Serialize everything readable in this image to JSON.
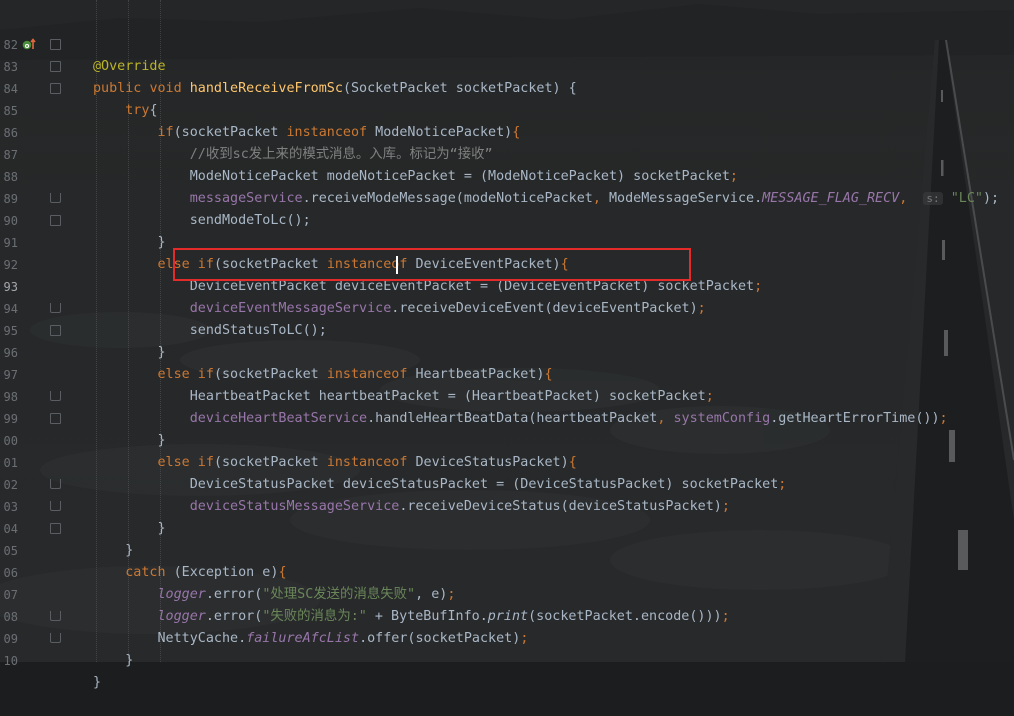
{
  "editor": {
    "current_line": "93",
    "lines": [
      {
        "num": "82",
        "text": ""
      },
      {
        "num": "83",
        "text": ""
      },
      {
        "num": "84",
        "text": ""
      },
      {
        "num": "85",
        "text": ""
      },
      {
        "num": "86",
        "text": ""
      },
      {
        "num": "87",
        "text": ""
      },
      {
        "num": "88",
        "text": ""
      },
      {
        "num": "89",
        "text": ""
      },
      {
        "num": "90",
        "text": ""
      },
      {
        "num": "91",
        "text": ""
      },
      {
        "num": "92",
        "text": ""
      },
      {
        "num": "93",
        "text": ""
      },
      {
        "num": "94",
        "text": ""
      },
      {
        "num": "95",
        "text": ""
      },
      {
        "num": "96",
        "text": ""
      },
      {
        "num": "97",
        "text": ""
      },
      {
        "num": "98",
        "text": ""
      },
      {
        "num": "99",
        "text": ""
      },
      {
        "num": "00",
        "text": ""
      },
      {
        "num": "01",
        "text": ""
      },
      {
        "num": "02",
        "text": ""
      },
      {
        "num": "03",
        "text": ""
      },
      {
        "num": "04",
        "text": ""
      },
      {
        "num": "05",
        "text": ""
      },
      {
        "num": "06",
        "text": ""
      },
      {
        "num": "07",
        "text": ""
      },
      {
        "num": "08",
        "text": ""
      },
      {
        "num": "09",
        "text": ""
      },
      {
        "num": "10",
        "text": ""
      }
    ]
  },
  "tokens": {
    "l82_ann": "@Override",
    "l83_public": "public",
    "l83_void": "void",
    "l83_name": "handleReceiveFromSc",
    "l83_params": "(SocketPacket socketPacket) {",
    "l84_try": "try",
    "l84_brace": "{",
    "l85_if": "if",
    "l85_a": "(socketPacket ",
    "l85_instanceof": "instanceof",
    "l85_b": " ModeNoticePacket)",
    "l85_brace": "{",
    "l86_comment": "//收到sc发上来的模式消息。入库。标记为“接收”",
    "l87_a": "ModeNoticePacket modeNoticePacket = ",
    "l87_b": "(ModeNoticePacket) socketPacket",
    "l87_semi": ";",
    "l88_svc": "messageService",
    "l88_a": ".receiveModeMessage(modeNoticePacket",
    "l88_comma": ",",
    "l88_b": " ModeMessageService.",
    "l88_const": "MESSAGE_FLAG_RECV",
    "l88_comma2": ",",
    "l88_hint": "s:",
    "l88_str": "\"LC\"",
    "l88_end": ");",
    "l89": "sendModeToLc();",
    "l90": "}",
    "l91_else": "else if",
    "l91_a": "(socketPacket ",
    "l91_instanceof": "instanceof",
    "l91_b": " DeviceEventPacket)",
    "l91_brace": "{",
    "l92_a": "DeviceEventPacket deviceEventPacket = ",
    "l92_b": "(DeviceEventPacket) socketPacket",
    "l92_semi": ";",
    "l93_svc": "deviceEventMessageService",
    "l93_a": ".receiveDeviceEvent(deviceEventPacket)",
    "l93_semi": ";",
    "l94": "sendStatusToLC();",
    "l95": "}",
    "l96_else": "else if",
    "l96_a": "(socketPacket ",
    "l96_instanceof": "instanceof",
    "l96_b": " HeartbeatPacket)",
    "l96_brace": "{",
    "l97_a": "HeartbeatPacket heartbeatPacket = ",
    "l97_b": "(HeartbeatPacket) socketPacket",
    "l97_semi": ";",
    "l98_svc": "deviceHeartBeatService",
    "l98_a": ".handleHeartBeatData(heartbeatPacket",
    "l98_comma": ",",
    "l98_cfg": " systemConfig",
    "l98_b": ".getHeartErrorTime())",
    "l98_semi": ";",
    "l99": "}",
    "l00_else": "else if",
    "l00_a": "(socketPacket ",
    "l00_instanceof": "instanceof",
    "l00_b": " DeviceStatusPacket)",
    "l00_brace": "{",
    "l01_a": "DeviceStatusPacket deviceStatusPacket = ",
    "l01_b": "(DeviceStatusPacket) socketPacket",
    "l01_semi": ";",
    "l02_svc": "deviceStatusMessageService",
    "l02_a": ".receiveDeviceStatus(deviceStatusPacket)",
    "l02_semi": ";",
    "l03": "}",
    "l04": "}",
    "l05_catch": "catch",
    "l05_a": " (Exception e)",
    "l05_brace": "{",
    "l06_logger": "logger",
    "l06_a": ".error(",
    "l06_str": "\"处理SC发送的消息失败\"",
    "l06_b": ", e)",
    "l06_semi": ";",
    "l07_logger": "logger",
    "l07_a": ".error(",
    "l07_str": "\"失败的消息为:\"",
    "l07_b": " + ByteBufInfo.",
    "l07_print": "print",
    "l07_c": "(socketPacket.encode()))",
    "l07_semi": ";",
    "l08_a": "NettyCache.",
    "l08_field": "failureAfcList",
    "l08_b": ".offer(socketPacket)",
    "l08_semi": ";",
    "l09": "}",
    "l10": "}"
  },
  "colors": {
    "keyword": "#cc7832",
    "annotation": "#bbb529",
    "method_decl": "#ffc66d",
    "field": "#9876aa",
    "string": "#6a8759",
    "comment": "#808080",
    "plain": "#a9b7c6",
    "highlight_box": "#e52a2a"
  },
  "icons": {
    "override_gutter": "override-implementation-icon",
    "fold": "fold-marker-icon"
  }
}
